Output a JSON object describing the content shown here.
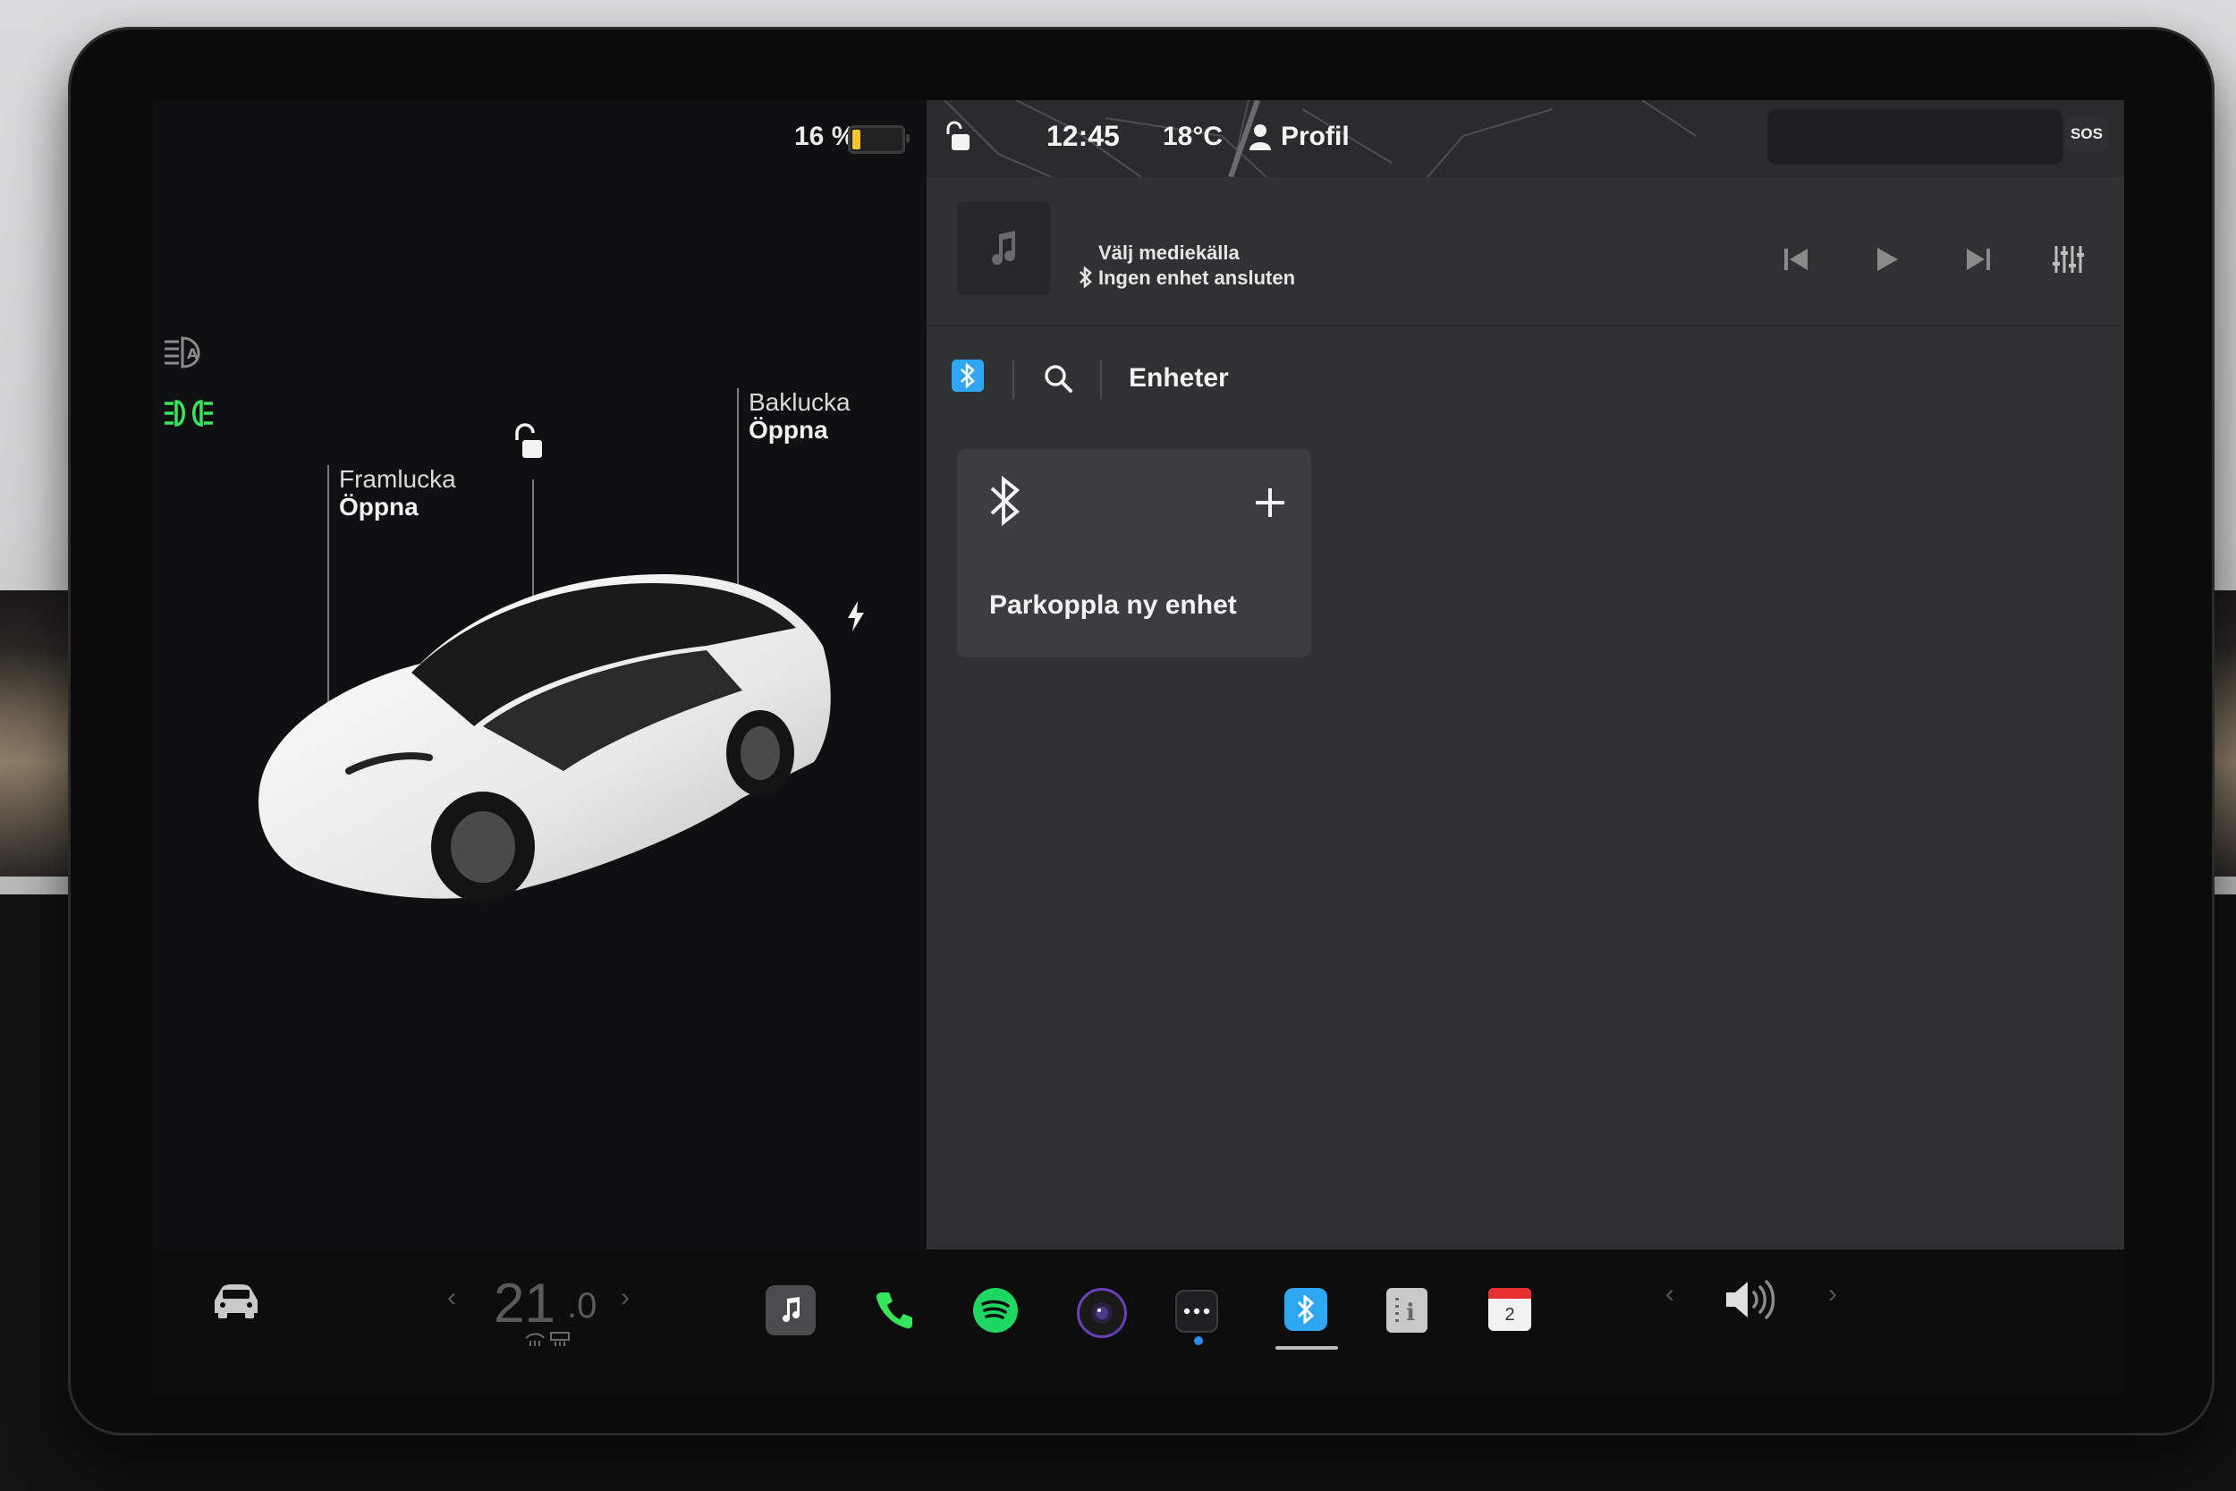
{
  "status": {
    "battery_percent": "16 %",
    "battery_level": 0.16,
    "time": "12:45",
    "temperature": "18°C",
    "profile_label": "Profil",
    "sos_label": "SOS"
  },
  "vehicle": {
    "frunk_title": "Framlucka",
    "frunk_action": "Öppna",
    "trunk_title": "Baklucka",
    "trunk_action": "Öppna"
  },
  "media": {
    "source_label": "Välj mediekälla",
    "device_status": "Ingen enhet ansluten"
  },
  "bluetooth": {
    "tab_devices": "Enheter",
    "pair_new_device": "Parkoppla ny enhet"
  },
  "climate": {
    "temp_whole": "21",
    "temp_decimal": ".0"
  },
  "dock": {
    "calendar_day": "2"
  },
  "colors": {
    "accent_blue": "#2fa7f2",
    "green_lights": "#35e55a",
    "spotify_green": "#1ed760",
    "battery_yellow": "#f4c430"
  }
}
